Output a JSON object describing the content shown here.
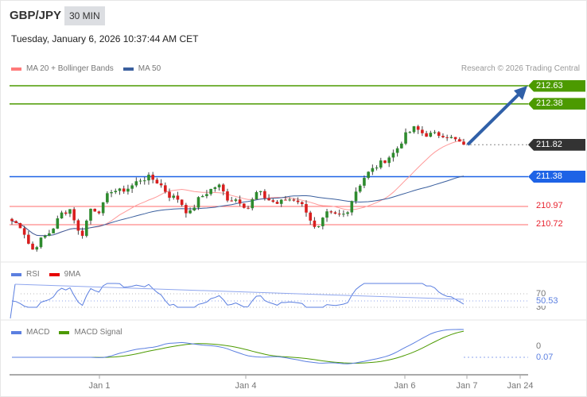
{
  "header": {
    "symbol": "GBP/JPY",
    "timeframe": "30 MIN",
    "timestamp": "Tuesday, January 6, 2026 10:37:44 AM CET"
  },
  "legend": {
    "ma20": "MA 20 + Bollinger Bands",
    "ma50": "MA 50",
    "ma20_color": "#ff7a7a",
    "ma50_color": "#3a5f9e"
  },
  "credit": "Research © 2026 Trading Central",
  "levels": [
    {
      "value": "212.63",
      "kind": "resistance",
      "color": "#4c9a00"
    },
    {
      "value": "212.38",
      "kind": "resistance",
      "color": "#4c9a00"
    },
    {
      "value": "211.82",
      "kind": "last",
      "color": "#333333"
    },
    {
      "value": "211.38",
      "kind": "pivot",
      "color": "#1e63e6"
    },
    {
      "value": "210.97",
      "kind": "support",
      "color": "#ff6b6b"
    },
    {
      "value": "210.72",
      "kind": "support",
      "color": "#ff6b6b"
    }
  ],
  "rsi": {
    "label": "RSI",
    "ma_label": "9MA",
    "levels": [
      "70",
      "30"
    ],
    "value": "50.53",
    "color": "#5b7fe0",
    "ma_color": "#e60000"
  },
  "macd": {
    "label": "MACD",
    "signal_label": "MACD Signal",
    "zero": "0",
    "value": "0.07",
    "color": "#5b7fe0",
    "signal_color": "#4c9a00"
  },
  "chart_data": {
    "type": "candlestick",
    "xticks": [
      "Jan 1",
      "Jan 4",
      "Jan 6",
      "Jan 7",
      "Jan 24"
    ],
    "ylim": [
      210.3,
      212.7
    ],
    "close_path": [
      210.77,
      210.69,
      210.36,
      210.52,
      210.63,
      210.87,
      210.94,
      210.52,
      210.94,
      210.91,
      211.2,
      211.18,
      211.23,
      211.34,
      211.37,
      211.29,
      211.12,
      211.07,
      210.85,
      211.07,
      211.18,
      211.27,
      211.07,
      211.07,
      210.94,
      211.18,
      211.07,
      211.01,
      211.07,
      211.07,
      210.91,
      210.61,
      210.87,
      210.85,
      210.87,
      211.18,
      211.4,
      211.51,
      211.61,
      211.72,
      211.94,
      212.05,
      211.96,
      211.96,
      211.96,
      211.89,
      211.82
    ],
    "forecast": {
      "from": 211.82,
      "to": 212.63,
      "direction": "up"
    }
  }
}
